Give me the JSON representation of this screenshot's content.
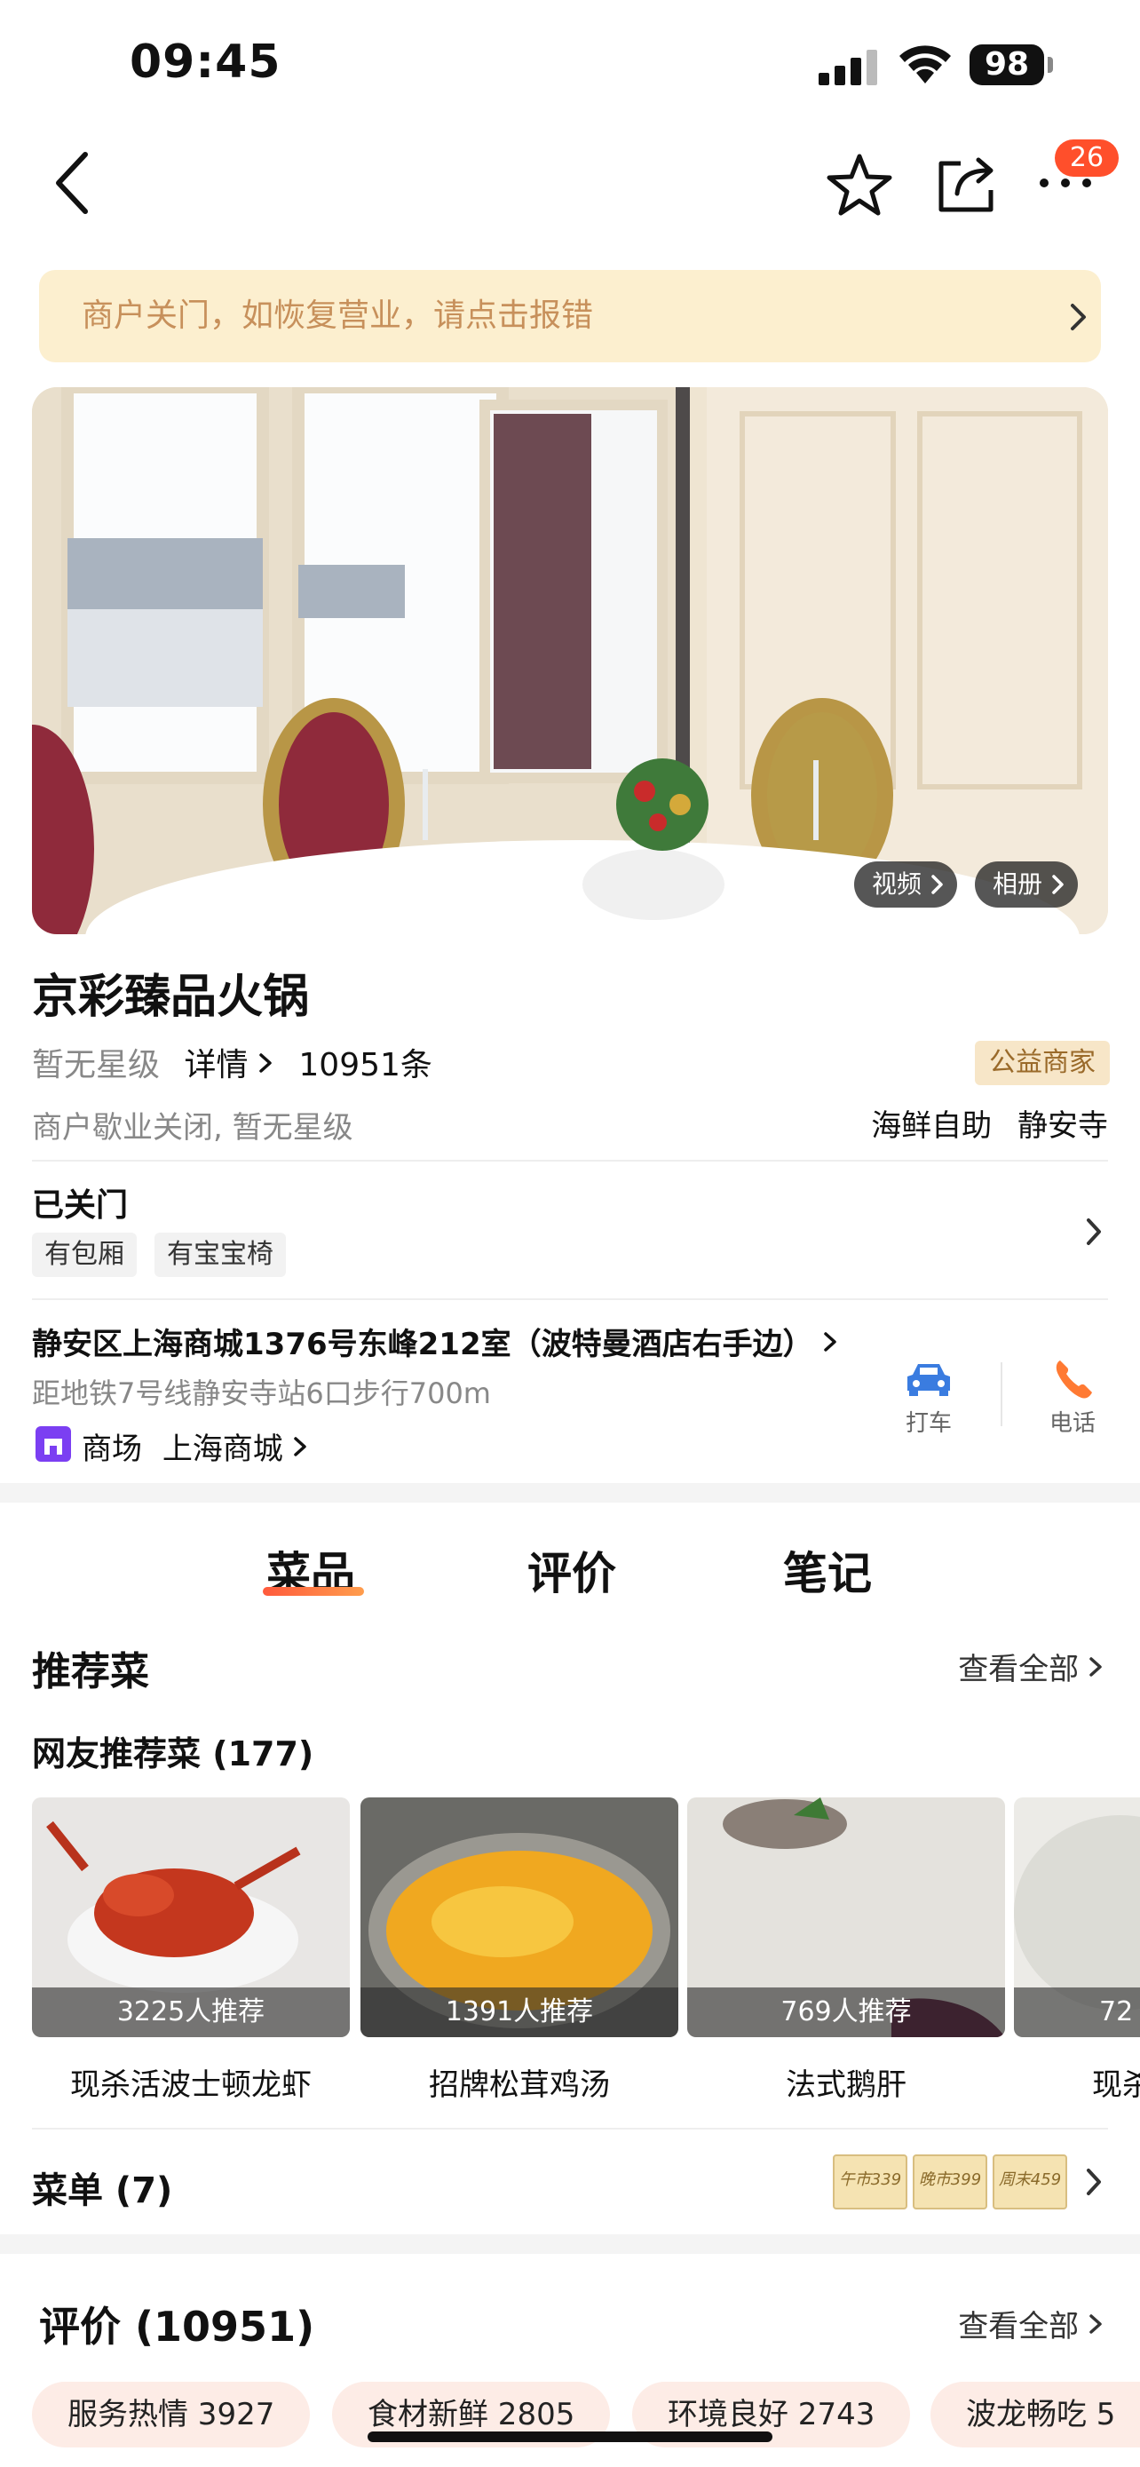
{
  "status_bar": {
    "time": "09:45",
    "battery": "98"
  },
  "nav": {
    "badge_count": "26"
  },
  "banner": {
    "text": "商户关门，如恢复营业，请点击报错"
  },
  "hero": {
    "video_label": "视频",
    "album_label": "相册"
  },
  "shop": {
    "name": "京彩臻品火锅",
    "star_text": "暂无星级",
    "details_label": "详情",
    "review_count_text": "10951条",
    "charity_tag": "公益商家",
    "status_note": "商户歇业关闭, 暂无星级",
    "category": "海鲜自助",
    "area": "静安寺",
    "open_status": "已关门",
    "facilities": [
      "有包厢",
      "有宝宝椅"
    ],
    "address": "静安区上海商城1376号东峰212室（波特曼酒店右手边）",
    "metro": "距地铁7号线静安寺站6口步行700m",
    "mall_prefix": "商场",
    "mall_name": "上海商城",
    "taxi_label": "打车",
    "phone_label": "电话"
  },
  "tabs": [
    "菜品",
    "评价",
    "笔记"
  ],
  "recommend": {
    "title": "推荐菜",
    "see_all": "查看全部",
    "subtitle": "网友推荐菜 (177)",
    "dishes": [
      {
        "count": "3225人推荐",
        "name": "现杀活波士顿龙虾"
      },
      {
        "count": "1391人推荐",
        "name": "招牌松茸鸡汤"
      },
      {
        "count": "769人推荐",
        "name": "法式鹅肝"
      },
      {
        "count": "72",
        "name": "现杀"
      }
    ]
  },
  "menu": {
    "title": "菜单 (7)",
    "thumbs": [
      "午市339",
      "晚市399",
      "周末459"
    ]
  },
  "reviews": {
    "title": "评价 (10951)",
    "see_all": "查看全部",
    "tags": [
      "服务热情 3927",
      "食材新鲜 2805",
      "环境良好 2743",
      "波龙畅吃 5"
    ]
  },
  "colors": {
    "accent": "#ff5a3c",
    "banner_bg": "#fcefcf",
    "banner_text": "#c7905b",
    "taxi_blue": "#3a7ce0",
    "phone_orange": "#ff7a33"
  }
}
